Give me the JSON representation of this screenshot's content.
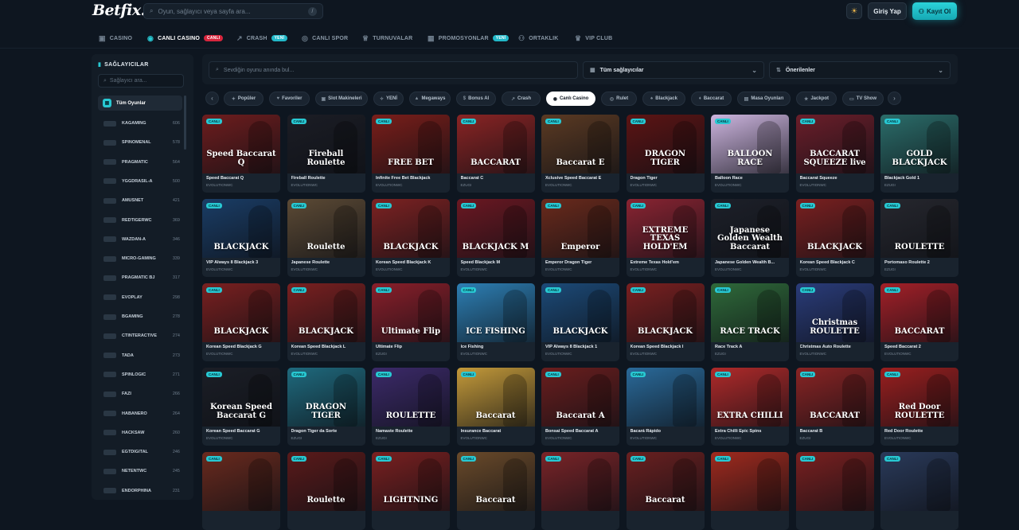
{
  "header": {
    "logo": "Betfix.",
    "search_placeholder": "Oyun, sağlayıcı veya sayfa ara...",
    "search_kbd": "/",
    "login_label": "Giriş Yap",
    "register_label": "Kayıt Ol"
  },
  "nav": [
    {
      "label": "CASINO",
      "icon": "casino-icon",
      "glyph": "▣"
    },
    {
      "label": "CANLI CASINO",
      "icon": "live-casino-icon",
      "glyph": "◉",
      "badge": "CANLI",
      "badge_color": "#d7263d",
      "active": true
    },
    {
      "label": "CRASH",
      "icon": "crash-icon",
      "glyph": "↗",
      "badge": "YENİ",
      "badge_color": "#22b8c8"
    },
    {
      "label": "CANLI SPOR",
      "icon": "sport-icon",
      "glyph": "◎"
    },
    {
      "label": "TURNUVALAR",
      "icon": "trophy-icon",
      "glyph": "♕"
    },
    {
      "label": "PROMOSYONLAR",
      "icon": "promo-icon",
      "glyph": "▦",
      "badge": "YENİ",
      "badge_color": "#22b8c8"
    },
    {
      "label": "ORTAKLIK",
      "icon": "partner-icon",
      "glyph": "⚇"
    },
    {
      "label": "VIP CLUB",
      "icon": "vip-icon",
      "glyph": "♛"
    }
  ],
  "sidebar": {
    "title": "SAĞLAYICILAR",
    "search_placeholder": "Sağlayıcı ara...",
    "all_label": "Tüm Oyunlar",
    "providers": [
      {
        "name": "KAGAMING",
        "count": "606"
      },
      {
        "name": "SPINOMENAL",
        "count": "578"
      },
      {
        "name": "PRAGMATIC",
        "count": "564"
      },
      {
        "name": "YGGDRASIL-A",
        "count": "500"
      },
      {
        "name": "AMUSNET",
        "count": "421"
      },
      {
        "name": "REDTIGERWC",
        "count": "369"
      },
      {
        "name": "WAZDAN-A",
        "count": "346"
      },
      {
        "name": "MICRO-GAMING",
        "count": "339"
      },
      {
        "name": "PRAGMATIC BJ",
        "count": "317"
      },
      {
        "name": "EVOPLAY",
        "count": "298"
      },
      {
        "name": "BGAMING",
        "count": "278"
      },
      {
        "name": "CTINTERACTIVE",
        "count": "274"
      },
      {
        "name": "TADA",
        "count": "273"
      },
      {
        "name": "SPINLOGIC",
        "count": "271"
      },
      {
        "name": "FAZI",
        "count": "266"
      },
      {
        "name": "HABANERO",
        "count": "264"
      },
      {
        "name": "HACKSAW",
        "count": "260"
      },
      {
        "name": "EGTDIGITAL",
        "count": "246"
      },
      {
        "name": "NETENTWC",
        "count": "245"
      },
      {
        "name": "ENDORPHINA",
        "count": "231"
      }
    ]
  },
  "filters": {
    "search_placeholder": "Sevdiğin oyunu anında bul...",
    "provider_select": "Tüm sağlayıcılar",
    "sort_select": "Önerilenler"
  },
  "chips": [
    {
      "label": "Popüler",
      "glyph": "✦"
    },
    {
      "label": "Favoriler",
      "glyph": "♥"
    },
    {
      "label": "Slot Makineleri",
      "glyph": "▣"
    },
    {
      "label": "YENİ",
      "glyph": "✧"
    },
    {
      "label": "Megaways",
      "glyph": "▲"
    },
    {
      "label": "Bonus Al",
      "glyph": "$"
    },
    {
      "label": "Crash",
      "glyph": "↗"
    },
    {
      "label": "Canlı Casino",
      "glyph": "◉",
      "active": true
    },
    {
      "label": "Rulet",
      "glyph": "◎"
    },
    {
      "label": "Blackjack",
      "glyph": "♠"
    },
    {
      "label": "Baccarat",
      "glyph": "♦"
    },
    {
      "label": "Masa Oyunları",
      "glyph": "▤"
    },
    {
      "label": "Jackpot",
      "glyph": "★"
    },
    {
      "label": "TV Show",
      "glyph": "▭"
    }
  ],
  "games": [
    {
      "name": "Speed Baccarat Q",
      "provider": "EVOLUTIONWC",
      "label": "Speed Baccarat Q",
      "bg": "#6e1d1e",
      "live": "CANLI"
    },
    {
      "name": "Fireball Roulette",
      "provider": "EVOLUTIONWC",
      "label": "Fireball Roulette",
      "bg": "#1b1d25",
      "live": "CANLI"
    },
    {
      "name": "Infinite Free Bet Blackjack",
      "provider": "EVOLUTIONWC",
      "label": "FREE BET",
      "bg": "#7a1e1a",
      "live": "CANLI"
    },
    {
      "name": "Baccarat C",
      "provider": "EZUGI",
      "label": "BACCARAT",
      "bg": "#8a2424",
      "live": "CANLI"
    },
    {
      "name": "Xclusive Speed Baccarat E",
      "provider": "EVOLUTIONWC",
      "label": "Baccarat E",
      "bg": "#5b3a23",
      "live": "CANLI"
    },
    {
      "name": "Dragon Tiger",
      "provider": "EVOLUTIONWC",
      "label": "DRAGON TIGER",
      "bg": "#5c1414",
      "live": "CANLI"
    },
    {
      "name": "Balloon Race",
      "provider": "EVOLUTIONWC",
      "label": "BALLOON RACE",
      "bg": "#cdb5df",
      "live": "CANLI"
    },
    {
      "name": "Baccarat Squeeze",
      "provider": "EVOLUTIONWC",
      "label": "BACCARAT SQUEEZE live",
      "bg": "#6b1e2a",
      "live": "CANLI"
    },
    {
      "name": "Blackjack Gold 1",
      "provider": "EZUGI",
      "label": "GOLD BLACKJACK",
      "bg": "#2b6d6a",
      "live": "CANLI"
    },
    {
      "name": "VIP Always 8 Blackjack 3",
      "provider": "EVOLUTIONWC",
      "label": "BLACKJACK",
      "bg": "#1a3d66",
      "live": "CANLI"
    },
    {
      "name": "Japanese Roulette",
      "provider": "EVOLUTIONWC",
      "label": "Roulette",
      "bg": "#5c4a35",
      "live": "CANLI"
    },
    {
      "name": "Korean Speed Blackjack K",
      "provider": "EVOLUTIONWC",
      "label": "BLACKJACK",
      "bg": "#7d2222",
      "live": "CANLI"
    },
    {
      "name": "Speed Blackjack M",
      "provider": "EVOLUTIONWC",
      "label": "BLACKJACK M",
      "bg": "#6b1822",
      "live": "CANLI"
    },
    {
      "name": "Emperor Dragon Tiger",
      "provider": "EVOLUTIONWC",
      "label": "Emperor",
      "bg": "#6a2a1c",
      "live": "CANLI"
    },
    {
      "name": "Extreme Texas Hold'em",
      "provider": "EVOLUTIONWC",
      "label": "EXTREME TEXAS HOLD'EM",
      "bg": "#8a2432",
      "live": "CANLI"
    },
    {
      "name": "Japanese Golden Wealth B...",
      "provider": "EVOLUTIONWC",
      "label": "Japanese Golden Wealth Baccarat",
      "bg": "#1d2029",
      "live": "CANLI"
    },
    {
      "name": "Korean Speed Blackjack C",
      "provider": "EVOLUTIONWC",
      "label": "BLACKJACK",
      "bg": "#7a2020",
      "live": "CANLI"
    },
    {
      "name": "Portomaso Roulette 2",
      "provider": "EZUGI",
      "label": "ROULETTE",
      "bg": "#26272e",
      "live": "CANLI"
    },
    {
      "name": "Korean Speed Blackjack G",
      "provider": "EVOLUTIONWC",
      "label": "BLACKJACK",
      "bg": "#7a2020",
      "live": "CANLI"
    },
    {
      "name": "Korean Speed Blackjack L",
      "provider": "EVOLUTIONWC",
      "label": "BLACKJACK",
      "bg": "#7a2020",
      "live": "CANLI"
    },
    {
      "name": "Ultimate Flip",
      "provider": "EZUGI",
      "label": "Ultimate Flip",
      "bg": "#8a1f2a",
      "live": "CANLI"
    },
    {
      "name": "Ice Fishing",
      "provider": "EVOLUTIONWC",
      "label": "ICE FISHING",
      "bg": "#2d7fb4",
      "live": "CANLI"
    },
    {
      "name": "VIP Always 8 Blackjack 1",
      "provider": "EVOLUTIONWC",
      "label": "BLACKJACK",
      "bg": "#1c4a78",
      "live": "CANLI"
    },
    {
      "name": "Korean Speed Blackjack I",
      "provider": "EVOLUTIONWC",
      "label": "BLACKJACK",
      "bg": "#7a2020",
      "live": "CANLI"
    },
    {
      "name": "Race Track A",
      "provider": "EZUGI",
      "label": "RACE TRACK",
      "bg": "#2f6a3a",
      "live": "CANLI"
    },
    {
      "name": "Christmas Auto Roulette",
      "provider": "EVOLUTIONWC",
      "label": "Christmas ROULETTE",
      "bg": "#2a3c7a",
      "live": "CANLI"
    },
    {
      "name": "Speed Baccarat 2",
      "provider": "EVOLUTIONWC",
      "label": "BACCARAT",
      "bg": "#a32028",
      "live": "CANLI"
    },
    {
      "name": "Korean Speed Baccarat G",
      "provider": "EVOLUTIONWC",
      "label": "Korean Speed Baccarat G",
      "bg": "#1b1e26",
      "live": "CANLI"
    },
    {
      "name": "Dragon Tiger da Sorte",
      "provider": "EZUGI",
      "label": "DRAGON TIGER",
      "bg": "#1f6a7e",
      "live": "CANLI"
    },
    {
      "name": "Namaste Roulette",
      "provider": "EZUGI",
      "label": "ROULETTE",
      "bg": "#3c2a6a",
      "live": "CANLI"
    },
    {
      "name": "Insurance Baccarat",
      "provider": "EVOLUTIONWC",
      "label": "Baccarat",
      "bg": "#c49a3a",
      "live": "CANLI"
    },
    {
      "name": "Bonsai Speed Baccarat A",
      "provider": "EVOLUTIONWC",
      "label": "Baccarat A",
      "bg": "#6a1e1e",
      "live": "CANLI"
    },
    {
      "name": "Bacará Rápido",
      "provider": "EVOLUTIONWC",
      "label": "",
      "bg": "#2a6a9a",
      "live": "CANLI"
    },
    {
      "name": "Extra Chilli Epic Spins",
      "provider": "EVOLUTIONWC",
      "label": "EXTRA CHILLI",
      "bg": "#b02a2a",
      "live": "CANLI"
    },
    {
      "name": "Baccarat B",
      "provider": "EZUGI",
      "label": "BACCARAT",
      "bg": "#8a2424",
      "live": "CANLI"
    },
    {
      "name": "Red Door Roulette",
      "provider": "EVOLUTIONWC",
      "label": "Red Door ROULETTE",
      "bg": "#9a1f1f",
      "live": "CANLI"
    },
    {
      "name": "",
      "provider": "",
      "label": "",
      "bg": "#6a2a1e",
      "live": "CANLI"
    },
    {
      "name": "",
      "provider": "",
      "label": "Roulette",
      "bg": "#5a1a1a",
      "live": "CANLI"
    },
    {
      "name": "",
      "provider": "",
      "label": "LIGHTNING",
      "bg": "#7a2020",
      "live": "CANLI"
    },
    {
      "name": "",
      "provider": "",
      "label": "Baccarat",
      "bg": "#6a4a2a",
      "live": "CANLI"
    },
    {
      "name": "",
      "provider": "",
      "label": "",
      "bg": "#7a2428",
      "live": "CANLI"
    },
    {
      "name": "",
      "provider": "",
      "label": "Baccarat",
      "bg": "#6a2020",
      "live": "CANLI"
    },
    {
      "name": "",
      "provider": "",
      "label": "",
      "bg": "#a02a1e",
      "live": "CANLI"
    },
    {
      "name": "",
      "provider": "",
      "label": "",
      "bg": "#7a2020",
      "live": "CANLI"
    },
    {
      "name": "",
      "provider": "",
      "label": "",
      "bg": "#2a3a5a",
      "live": "CANLI"
    }
  ]
}
